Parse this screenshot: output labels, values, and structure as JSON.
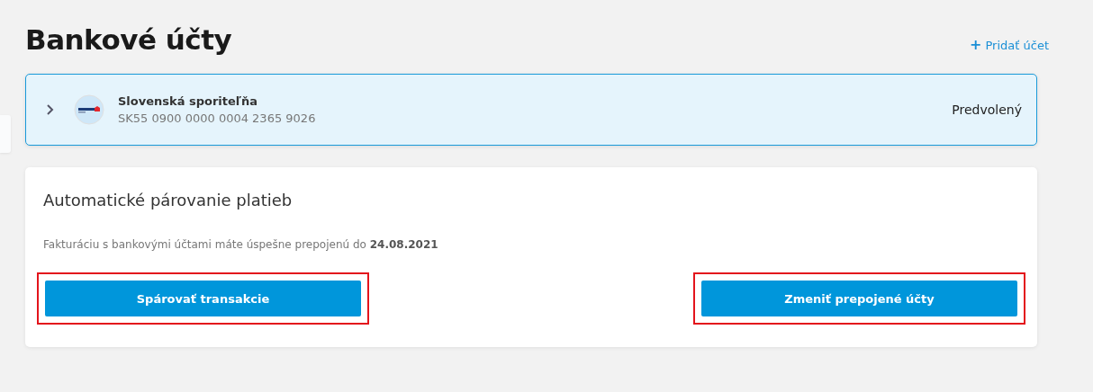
{
  "page": {
    "title": "Bankové účty",
    "add_link": {
      "icon": "+",
      "label": "Pridať účet"
    }
  },
  "accounts": [
    {
      "name": "Slovenská sporiteľňa",
      "iban": "SK55 0900 0000 0004 2365 9026",
      "badge": "Predvolený",
      "selected": true,
      "expanded": false
    }
  ],
  "pairing": {
    "title": "Automatické párovanie platieb",
    "text": "Fakturáciu s bankovými účtami máte úspešne prepojenú do **24.08.2021**",
    "buttons": [
      {
        "label": "Spárovať transakcie",
        "highlighted": true
      },
      {
        "label": "Zmeniť prepojené účty",
        "highlighted": true
      }
    ]
  }
}
